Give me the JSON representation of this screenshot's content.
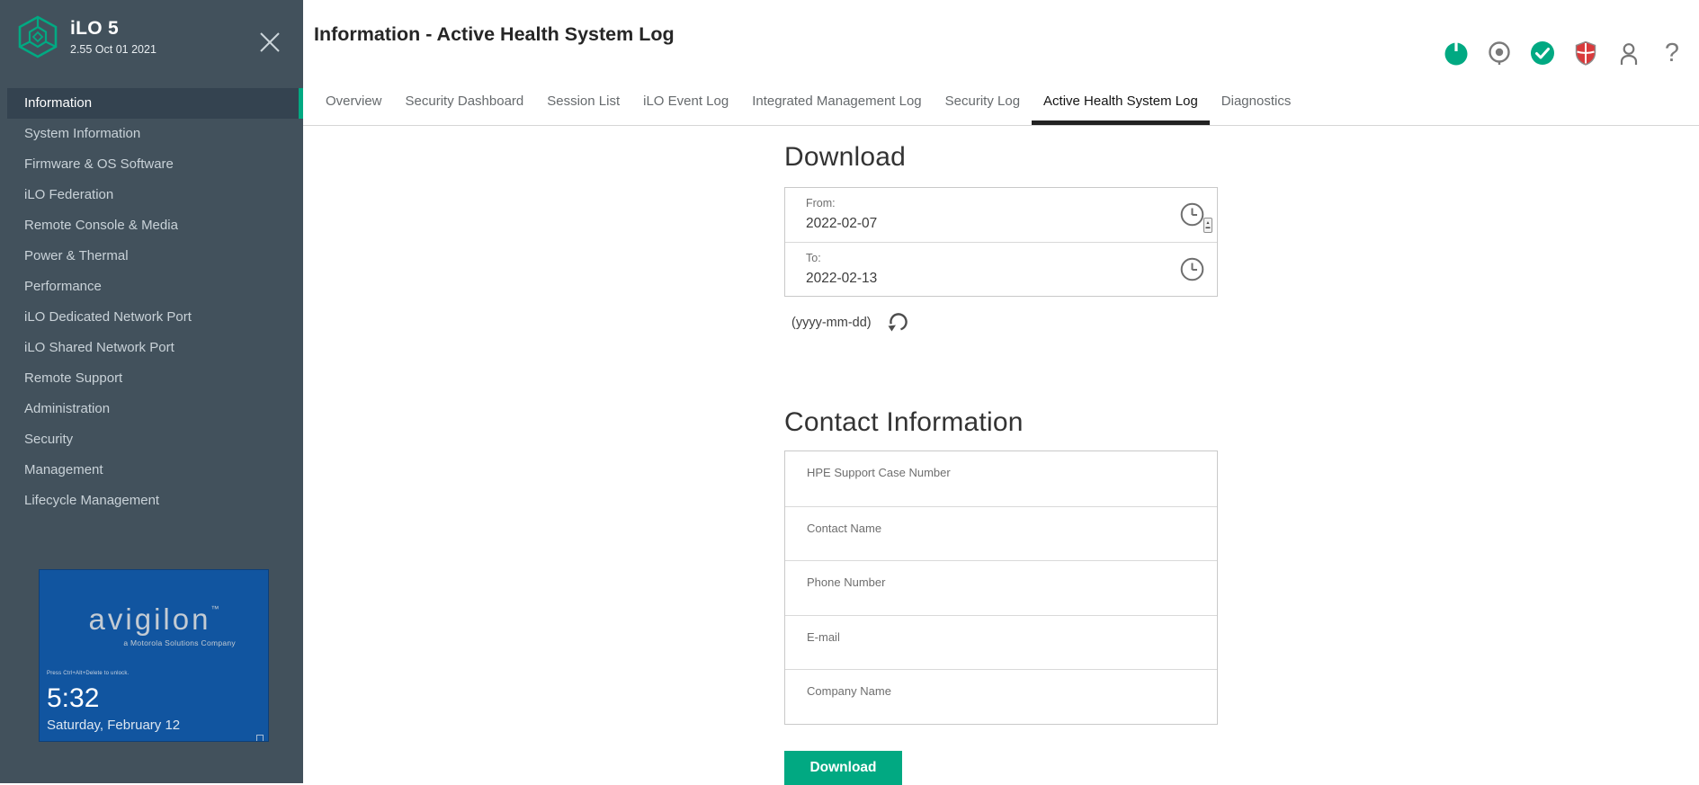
{
  "sidebar": {
    "app_title": "iLO 5",
    "version": "2.55 Oct 01 2021",
    "items": [
      {
        "label": "Information",
        "selected": true
      },
      {
        "label": "System Information",
        "selected": false
      },
      {
        "label": "Firmware & OS Software",
        "selected": false
      },
      {
        "label": "iLO Federation",
        "selected": false
      },
      {
        "label": "Remote Console & Media",
        "selected": false
      },
      {
        "label": "Power & Thermal",
        "selected": false
      },
      {
        "label": "Performance",
        "selected": false
      },
      {
        "label": "iLO Dedicated Network Port",
        "selected": false
      },
      {
        "label": "iLO Shared Network Port",
        "selected": false
      },
      {
        "label": "Remote Support",
        "selected": false
      },
      {
        "label": "Administration",
        "selected": false
      },
      {
        "label": "Security",
        "selected": false
      },
      {
        "label": "Management",
        "selected": false
      },
      {
        "label": "Lifecycle Management",
        "selected": false
      }
    ],
    "console_preview": {
      "brand": "avigilon",
      "brand_tm": "™",
      "brand_sub": "a Motorola Solutions Company",
      "lock_hint": "Press Ctrl+Alt+Delete to unlock.",
      "time": "5:32",
      "date": "Saturday, February 12"
    }
  },
  "header": {
    "title": "Information - Active Health System Log",
    "icons": [
      "power-status",
      "uid-indicator",
      "health-status",
      "security-status",
      "user",
      "help"
    ],
    "help_glyph": "?"
  },
  "tabs": [
    {
      "label": "Overview",
      "active": false
    },
    {
      "label": "Security Dashboard",
      "active": false
    },
    {
      "label": "Session List",
      "active": false
    },
    {
      "label": "iLO Event Log",
      "active": false
    },
    {
      "label": "Integrated Management Log",
      "active": false
    },
    {
      "label": "Security Log",
      "active": false
    },
    {
      "label": "Active Health System Log",
      "active": true
    },
    {
      "label": "Diagnostics",
      "active": false
    }
  ],
  "download": {
    "heading": "Download",
    "from_label": "From:",
    "from_value": "2022-02-07",
    "to_label": "To:",
    "to_value": "2022-02-13",
    "format_hint": "(yyyy-mm-dd)",
    "button_label": "Download"
  },
  "contact": {
    "heading": "Contact Information",
    "fields": [
      {
        "placeholder": "HPE Support Case Number"
      },
      {
        "placeholder": "Contact Name"
      },
      {
        "placeholder": "Phone Number"
      },
      {
        "placeholder": "E-mail"
      },
      {
        "placeholder": "Company Name"
      }
    ]
  },
  "colors": {
    "accent_green": "#01a982",
    "sidebar_bg": "#42515c",
    "sidebar_selected_bg": "#344350",
    "console_blue": "#1155a0",
    "shield_red": "#d93a3c",
    "active_tab_underline": "#222222"
  }
}
